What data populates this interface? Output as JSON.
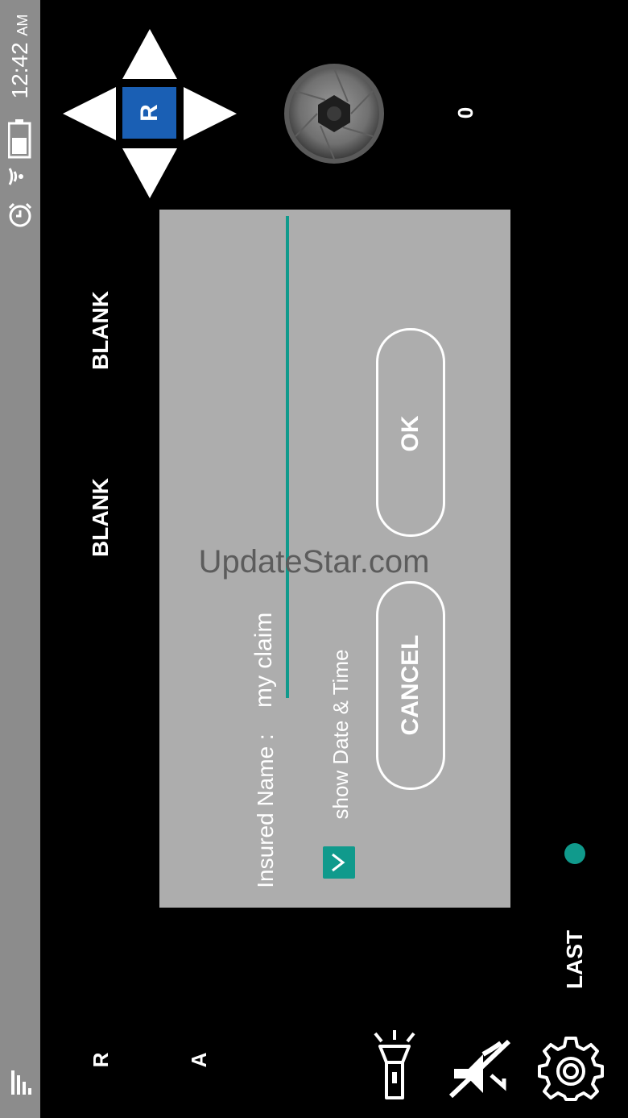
{
  "status_bar": {
    "time": "12:42",
    "ampm": "AM",
    "icons": [
      "alarm-icon",
      "wifi-icon",
      "battery-icon",
      "signal-icon"
    ]
  },
  "dpad": {
    "center_label": "R",
    "arrows": [
      "up",
      "down",
      "left",
      "right"
    ],
    "center_color": "#1a5fb4"
  },
  "camera": {
    "shutter_icon": "camera-aperture-icon",
    "shot_count": "0"
  },
  "labels": {
    "blank_1": "BLANK",
    "blank_2": "BLANK",
    "last": "LAST",
    "r": "R",
    "a": "A"
  },
  "dialog": {
    "insured_label": "Insured Name :",
    "insured_value": "my claim",
    "show_date_label": "show Date & Time",
    "show_date_checked": true,
    "ok_label": "OK",
    "cancel_label": "CANCEL",
    "accent_color": "#109a8c"
  },
  "watermark": "UpdateStar.com",
  "toolbar": {
    "icons": [
      "flashlight-icon",
      "mute-icon",
      "gear-icon"
    ]
  }
}
